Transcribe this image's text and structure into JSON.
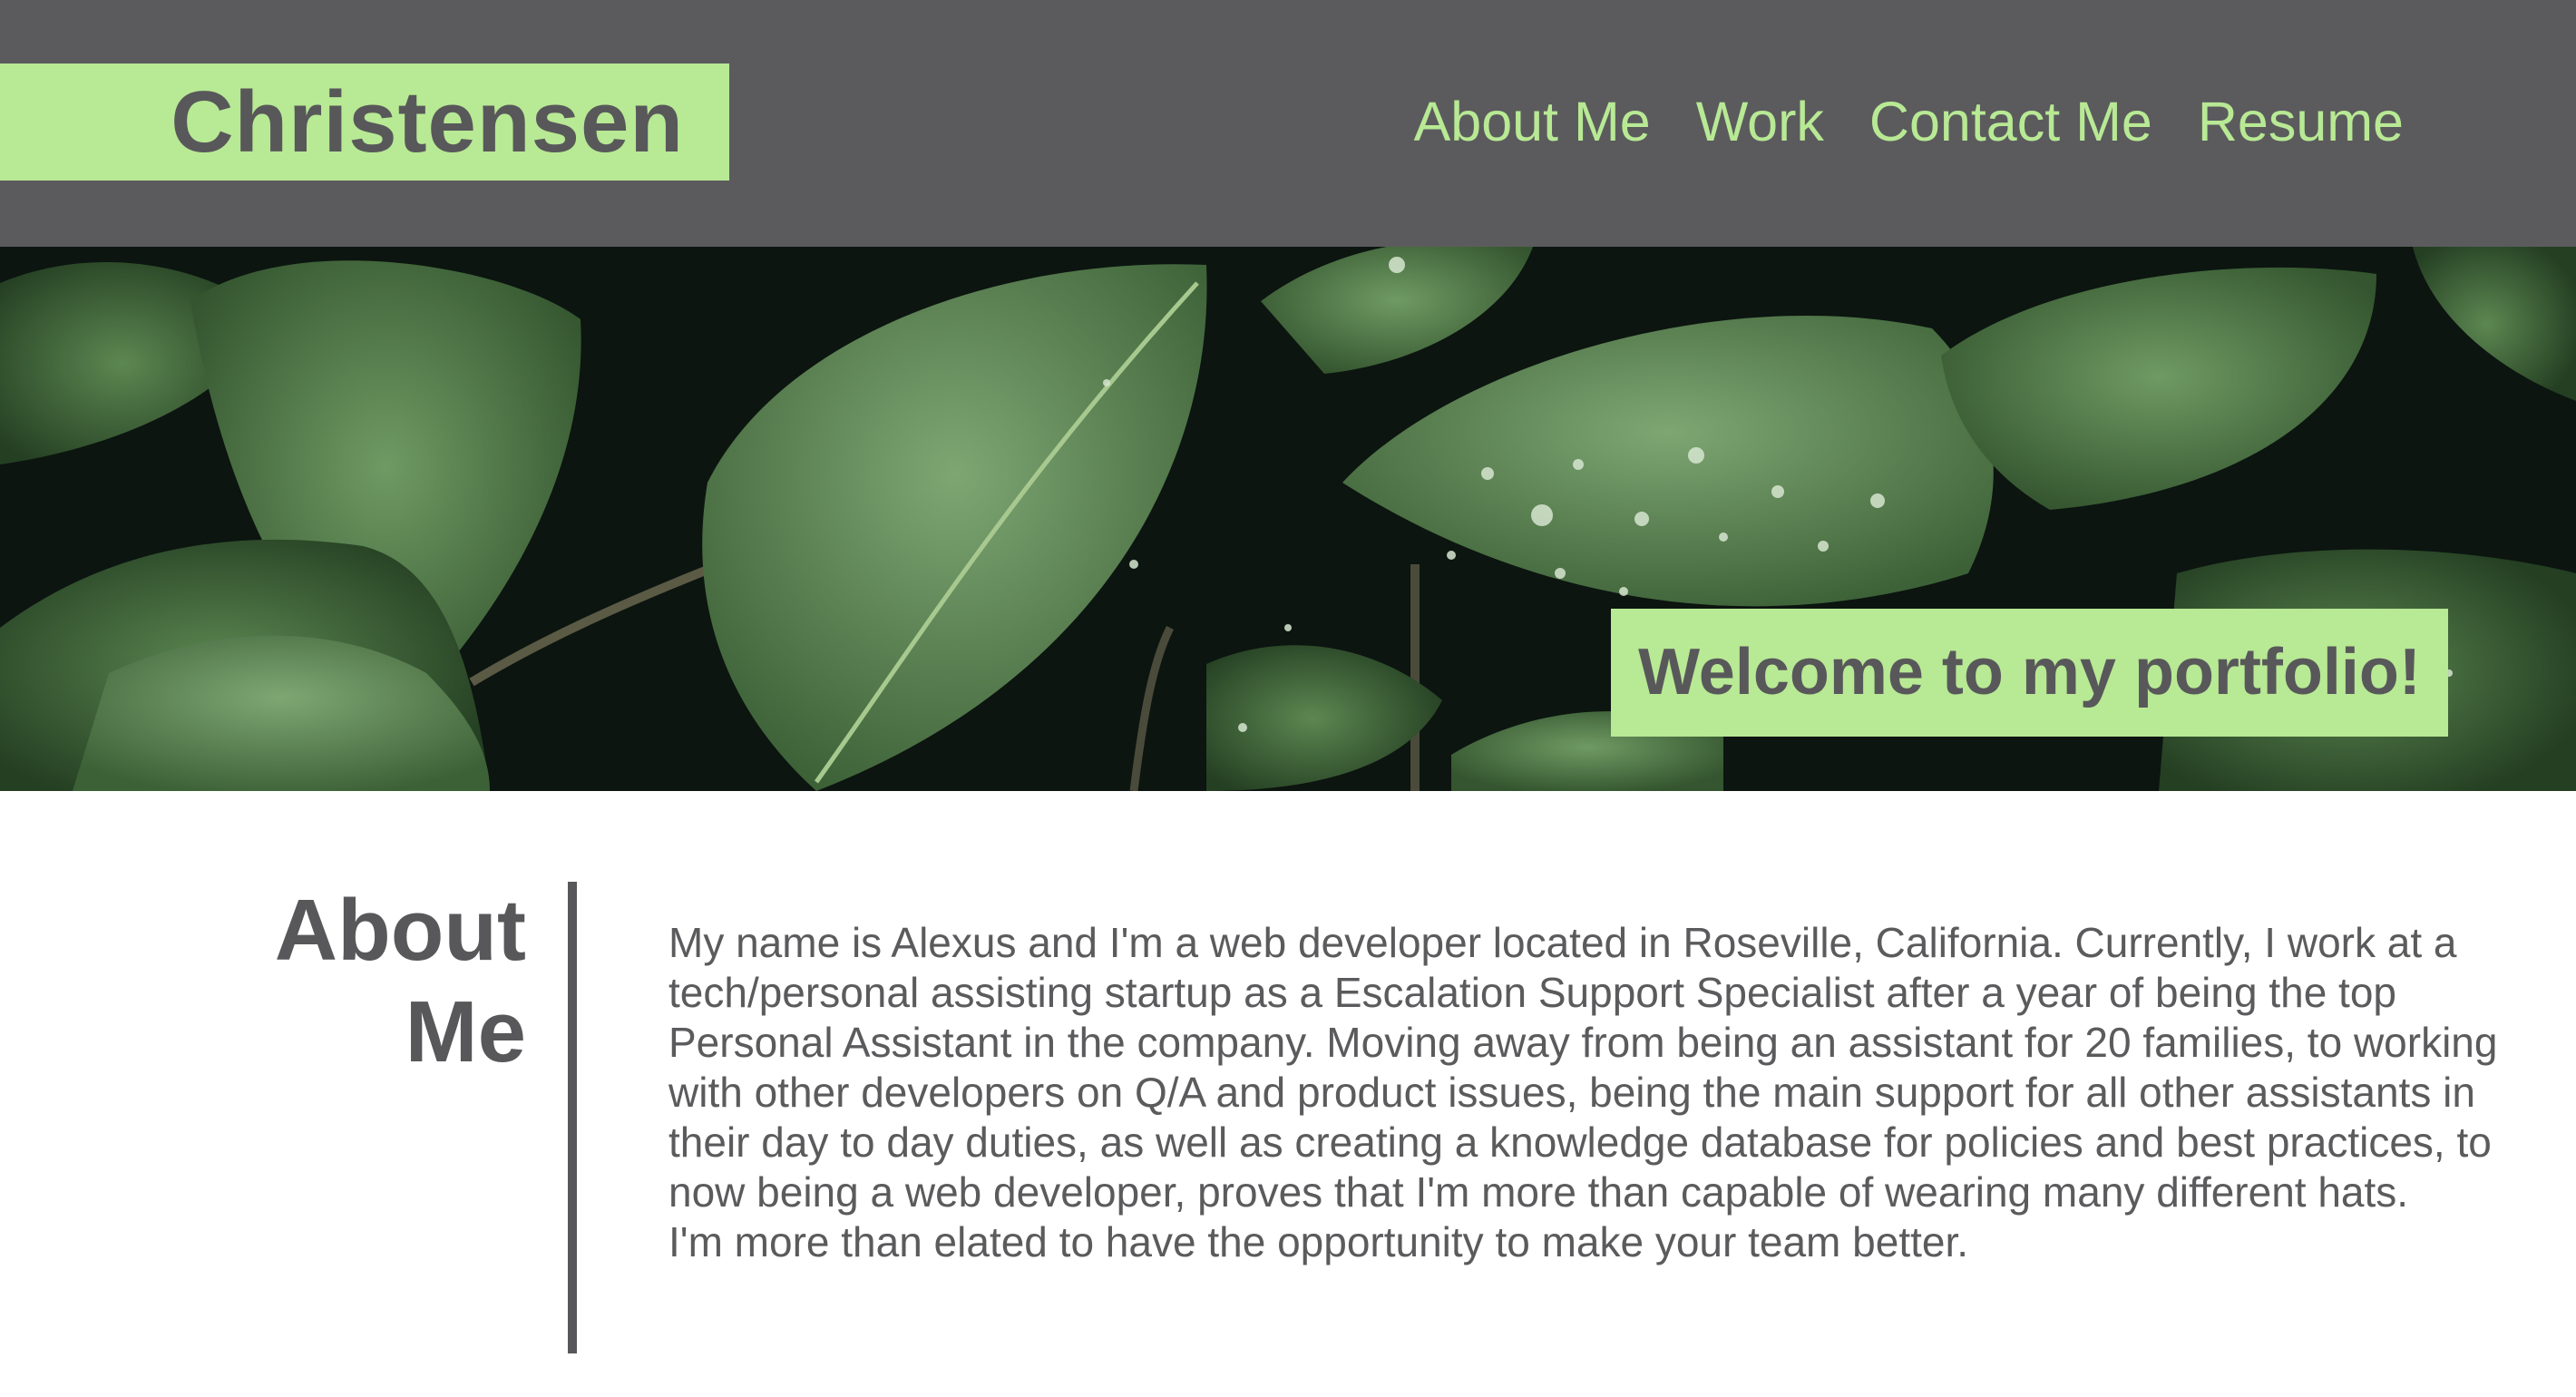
{
  "header": {
    "brand": "Christensen",
    "nav": [
      {
        "label": "About Me"
      },
      {
        "label": "Work"
      },
      {
        "label": "Contact Me"
      },
      {
        "label": "Resume"
      }
    ]
  },
  "hero": {
    "image": "leaves-with-water-droplets",
    "welcome": "Welcome to my portfolio!"
  },
  "about": {
    "title": "About Me",
    "paragraph1": "My name is Alexus and I'm a web developer located in Roseville, California. Currently, I work at a tech/personal assisting startup as a Escalation Support Specialist after a year of being the top Personal Assistant in the company. Moving away from being an assistant for 20 families, to working with other developers on Q/A and product issues, being the main support for all other assistants in their day to day duties, as well as creating a knowledge database for policies and best practices, to now being a web developer, proves that I'm more than capable of wearing many different hats.",
    "paragraph2": "I'm more than elated to have the opportunity to make your team better."
  },
  "colors": {
    "header_bg": "#5b5b5d",
    "accent": "#b8e994",
    "text": "#58585a"
  }
}
